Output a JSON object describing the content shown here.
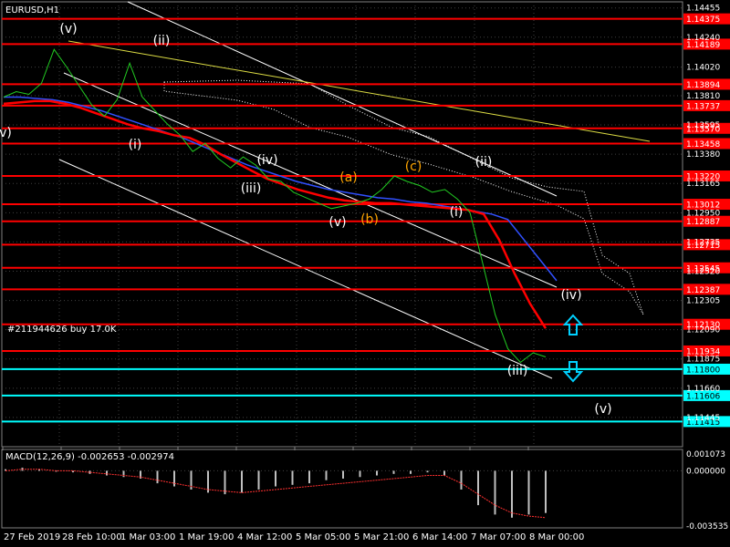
{
  "chart_data": {
    "type": "candlestick",
    "symbol_title": "EURUSD,H1",
    "order_label": "#211944626 buy 17.0K",
    "price_ticks": [
      "1.14455",
      "1.14240",
      "1.14020",
      "1.13810",
      "1.13595",
      "1.13380",
      "1.13165",
      "1.12950",
      "1.12735",
      "1.12520",
      "1.12305",
      "1.12090",
      "1.11875",
      "1.11660",
      "1.11445"
    ],
    "resistance_levels": [
      {
        "label": "1.14375",
        "value": 1.14375
      },
      {
        "label": "1.14189",
        "value": 1.14189
      },
      {
        "label": "1.13894",
        "value": 1.13894
      },
      {
        "label": "1.13737",
        "value": 1.13737
      },
      {
        "label": "1.13570",
        "value": 1.1357
      },
      {
        "label": "1.13458",
        "value": 1.13458
      },
      {
        "label": "1.13220",
        "value": 1.1322
      },
      {
        "label": "1.13012",
        "value": 1.13012
      },
      {
        "label": "1.12887",
        "value": 1.12887
      },
      {
        "label": "1.12715",
        "value": 1.12715
      },
      {
        "label": "1.12545",
        "value": 1.12545
      },
      {
        "label": "1.12387",
        "value": 1.12387
      },
      {
        "label": "1.12130",
        "value": 1.1213
      },
      {
        "label": "1.11934",
        "value": 1.11934
      }
    ],
    "support_levels": [
      {
        "label": "1.11800",
        "value": 1.118
      },
      {
        "label": "1.11606",
        "value": 1.11606
      },
      {
        "label": "1.11415",
        "value": 1.11415
      }
    ],
    "time_labels": [
      "27 Feb 2019",
      "28 Feb 10:00",
      "1 Mar 03:00",
      "1 Mar 19:00",
      "4 Mar 12:00",
      "5 Mar 05:00",
      "5 Mar 21:00",
      "6 Mar 14:00",
      "7 Mar 07:00",
      "8 Mar 00:00"
    ],
    "price_series_close": [
      1.138,
      1.1384,
      1.1382,
      1.139,
      1.1415,
      1.1402,
      1.1388,
      1.1374,
      1.1366,
      1.1378,
      1.1405,
      1.138,
      1.137,
      1.136,
      1.1352,
      1.134,
      1.1346,
      1.1335,
      1.1328,
      1.1336,
      1.133,
      1.132,
      1.1318,
      1.131,
      1.1306,
      1.1302,
      1.1298,
      1.13,
      1.1302,
      1.1305,
      1.1312,
      1.1322,
      1.1318,
      1.1315,
      1.131,
      1.1312,
      1.1305,
      1.1295,
      1.1258,
      1.122,
      1.1195,
      1.1185,
      1.1192,
      1.1189
    ],
    "ma_red": [
      1.1375,
      1.1376,
      1.1377,
      1.1377,
      1.1375,
      1.1372,
      1.1368,
      1.1364,
      1.136,
      1.1357,
      1.1355,
      1.1352,
      1.135,
      1.1345,
      1.1338,
      1.1332,
      1.1326,
      1.132,
      1.1316,
      1.1312,
      1.1309,
      1.1306,
      1.1304,
      1.1303,
      1.1302,
      1.1302,
      1.1301,
      1.13,
      1.1299,
      1.1298,
      1.1297,
      1.1294,
      1.1275,
      1.125,
      1.1228,
      1.121
    ],
    "ma_blue": [
      1.138,
      1.138,
      1.1379,
      1.1378,
      1.1376,
      1.1373,
      1.137,
      1.1366,
      1.1362,
      1.1358,
      1.1354,
      1.135,
      1.1345,
      1.134,
      1.1335,
      1.133,
      1.1326,
      1.1322,
      1.1318,
      1.1315,
      1.1312,
      1.131,
      1.1308,
      1.1306,
      1.1305,
      1.1303,
      1.1302,
      1.13,
      1.1298,
      1.1296,
      1.1294,
      1.129,
      1.1275,
      1.126,
      1.1245
    ],
    "wave_labels": [
      {
        "text": "(v)",
        "color": "#ffffff"
      },
      {
        "text": "(ii)",
        "color": "#ffffff"
      },
      {
        "text": "(i)",
        "color": "#ffffff"
      },
      {
        "text": "(iv)",
        "color": "#ffffff"
      },
      {
        "text": "(iii)",
        "color": "#ffffff"
      },
      {
        "text": "(a)",
        "color": "#ffa500"
      },
      {
        "text": "(b)",
        "color": "#ffa500"
      },
      {
        "text": "(c)",
        "color": "#ffa500"
      },
      {
        "text": "(v)",
        "color": "#ffffff"
      },
      {
        "text": "(ii)",
        "color": "#ffffff"
      },
      {
        "text": "(i)",
        "color": "#ffffff"
      },
      {
        "text": "(iii)",
        "color": "#ffffff"
      },
      {
        "text": "(iv)",
        "color": "#ffffff"
      },
      {
        "text": "(v)",
        "color": "#ffffff"
      },
      {
        "text": "v)",
        "color": "#ffffff"
      }
    ],
    "macd": {
      "label": "MACD(12,26,9) -0.002653 -0.002974",
      "ticks": [
        "0.001073",
        "0.000000",
        "-0.003535"
      ],
      "values": [
        0.0001,
        0.0002,
        0.0001,
        0.0,
        -0.0001,
        -0.0002,
        -0.0003,
        -0.0004,
        -0.0005,
        -0.0008,
        -0.001,
        -0.0012,
        -0.0014,
        -0.0015,
        -0.0014,
        -0.0012,
        -0.001,
        -0.0009,
        -0.0008,
        -0.0006,
        -0.0005,
        -0.0004,
        -0.0003,
        -0.0002,
        -0.0002,
        -0.0001,
        -0.0003,
        -0.0012,
        -0.0022,
        -0.0028,
        -0.003,
        -0.0028,
        -0.0027
      ],
      "signal": [
        0.0,
        0.0001,
        0.0001,
        0.0,
        0.0,
        -0.0001,
        -0.0002,
        -0.0003,
        -0.0004,
        -0.0006,
        -0.0008,
        -0.001,
        -0.0012,
        -0.0013,
        -0.0014,
        -0.0013,
        -0.0012,
        -0.0011,
        -0.001,
        -0.0009,
        -0.0008,
        -0.0007,
        -0.0006,
        -0.0005,
        -0.0004,
        -0.0003,
        -0.0003,
        -0.0008,
        -0.0015,
        -0.0022,
        -0.0027,
        -0.0029,
        -0.003
      ]
    },
    "colors": {
      "background": "#000000",
      "resistance": "#ff0000",
      "support": "#00ffff",
      "price": "#22cc22",
      "ma_red": "#ff0000",
      "ma_blue": "#3050ff",
      "trend_yellow": "#dddd44",
      "channel": "#ffffff",
      "cloud": "#ffffff",
      "arrow": "#00d0ff"
    },
    "ylim": [
      1.1123,
      1.145
    ]
  }
}
